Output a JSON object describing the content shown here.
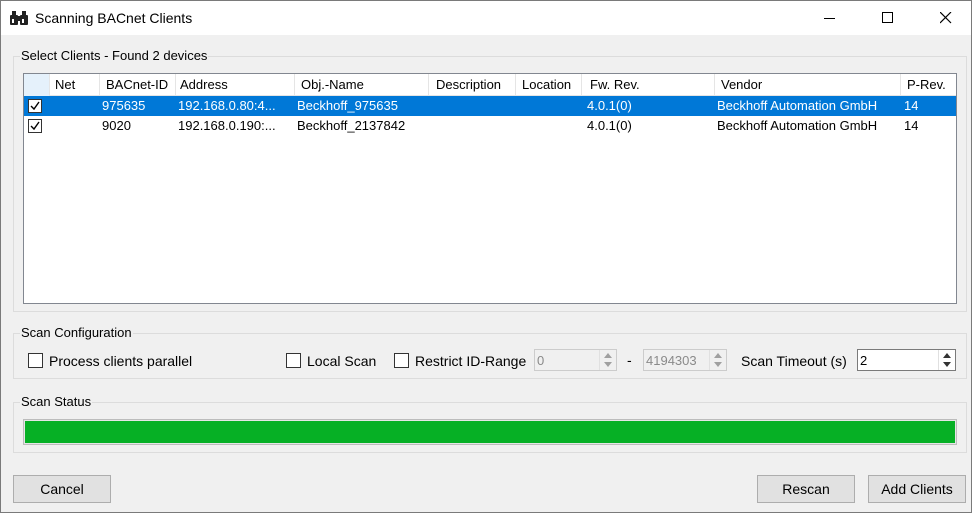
{
  "window": {
    "title": "Scanning BACnet Clients",
    "icon": "binoculars-icon"
  },
  "select_clients": {
    "label": "Select Clients - Found 2 devices",
    "columns": [
      "Net",
      "BACnet-ID",
      "Address",
      "Obj.-Name",
      "Description",
      "Location",
      "Fw. Rev.",
      "Vendor",
      "P-Rev."
    ],
    "rows": [
      {
        "checked": true,
        "selected": true,
        "net": "",
        "bacnet_id": "975635",
        "address": "192.168.0.80:4...",
        "obj_name": "Beckhoff_975635",
        "description": "",
        "location": "",
        "fw_rev": "4.0.1(0)",
        "vendor": "Beckhoff Automation GmbH",
        "p_rev": "14"
      },
      {
        "checked": true,
        "selected": false,
        "net": "",
        "bacnet_id": "9020",
        "address": "192.168.0.190:...",
        "obj_name": "Beckhoff_2137842",
        "description": "",
        "location": "",
        "fw_rev": "4.0.1(0)",
        "vendor": "Beckhoff Automation GmbH",
        "p_rev": "14"
      }
    ]
  },
  "scan_config": {
    "label": "Scan Configuration",
    "process_parallel": {
      "label": "Process clients parallel",
      "checked": false
    },
    "local_scan": {
      "label": "Local Scan",
      "checked": false
    },
    "restrict_range": {
      "label": "Restrict ID-Range",
      "checked": false
    },
    "range_from": "0",
    "range_separator": "-",
    "range_to": "4194303",
    "timeout_label": "Scan Timeout (s)",
    "timeout_value": "2"
  },
  "scan_status": {
    "label": "Scan Status",
    "progress_percent": 100,
    "progress_color": "#06b025"
  },
  "buttons": {
    "cancel": "Cancel",
    "rescan": "Rescan",
    "add_clients": "Add  Clients"
  },
  "colors": {
    "selection": "#0078d7"
  }
}
